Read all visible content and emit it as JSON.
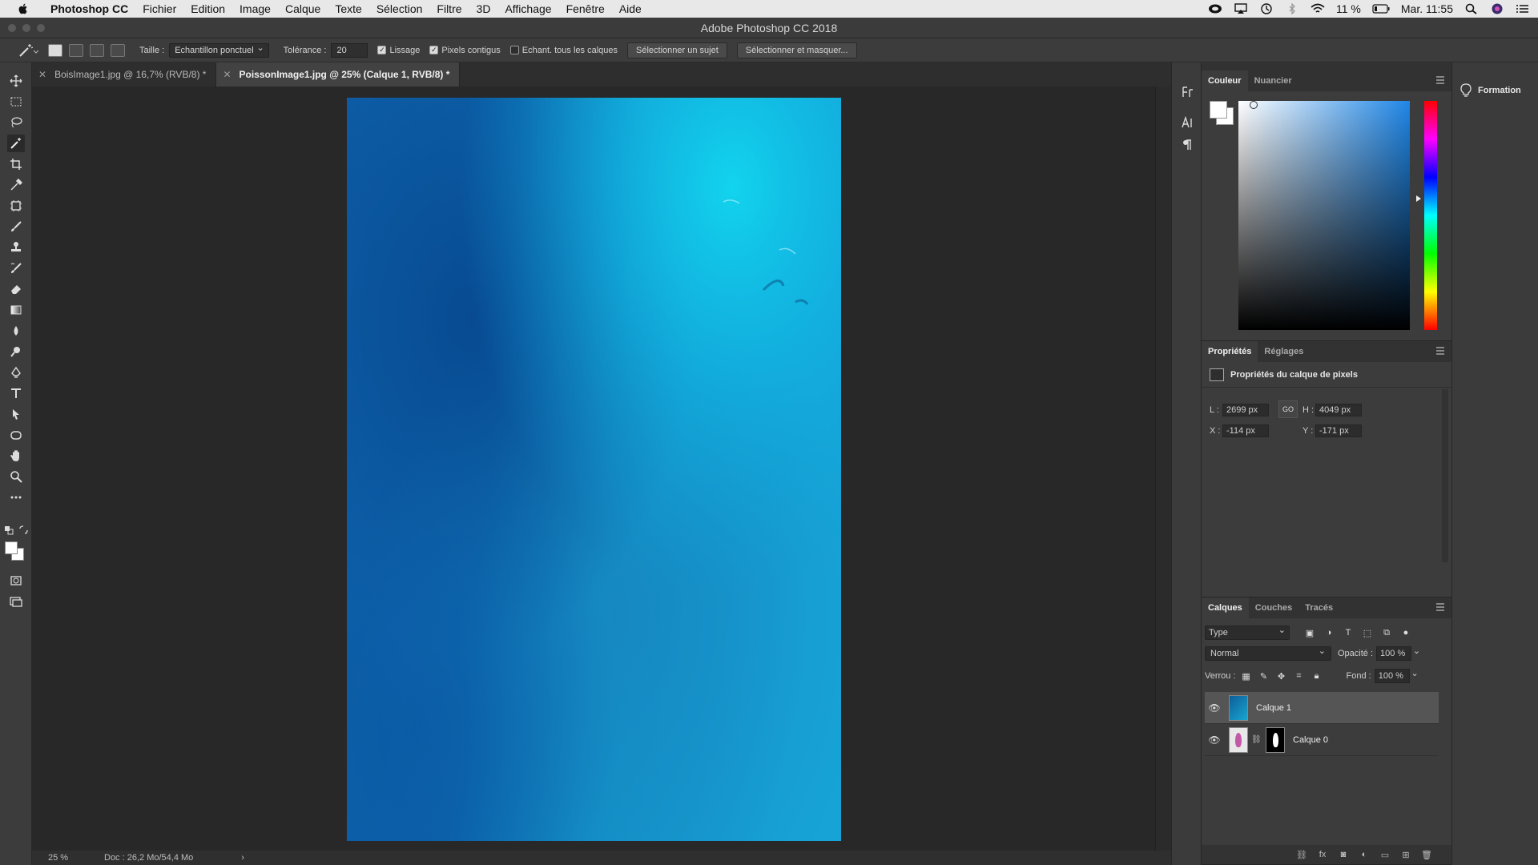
{
  "menubar": {
    "app": "Photoshop CC",
    "items": [
      "Fichier",
      "Edition",
      "Image",
      "Calque",
      "Texte",
      "Sélection",
      "Filtre",
      "3D",
      "Affichage",
      "Fenêtre",
      "Aide"
    ],
    "battery": "11 %",
    "clock": "Mar. 11:55"
  },
  "window": {
    "title": "Adobe Photoshop CC 2018"
  },
  "options": {
    "size_label": "Taille :",
    "size_value": "Echantillon ponctuel",
    "tolerance_label": "Tolérance :",
    "tolerance_value": "20",
    "antialias": {
      "label": "Lissage",
      "checked": true
    },
    "contiguous": {
      "label": "Pixels contigus",
      "checked": true
    },
    "sample_all": {
      "label": "Echant. tous les calques",
      "checked": false
    },
    "select_subject": "Sélectionner un sujet",
    "select_mask": "Sélectionner et masquer..."
  },
  "tabs": [
    {
      "label": "BoisImage1.jpg @ 16,7% (RVB/8) *",
      "active": false
    },
    {
      "label": "PoissonImage1.jpg @ 25% (Calque 1, RVB/8) *",
      "active": true
    }
  ],
  "status": {
    "zoom": "25 %",
    "doc": "Doc : 26,2 Mo/54,4 Mo",
    "arrow": "›"
  },
  "color_panel": {
    "tabs": [
      "Couleur",
      "Nuancier"
    ],
    "foreground": "#ffffff",
    "hue": "#1f86e6"
  },
  "properties_panel": {
    "tabs": [
      "Propriétés",
      "Réglages"
    ],
    "section_title": "Propriétés du calque de pixels",
    "w_label": "L :",
    "w_value": "2699 px",
    "h_label": "H :",
    "h_value": "4049 px",
    "x_label": "X :",
    "x_value": "-114 px",
    "y_label": "Y :",
    "y_value": "-171 px",
    "link_label": "GO"
  },
  "layers_panel": {
    "tabs": [
      "Calques",
      "Couches",
      "Tracés"
    ],
    "filter": "Type",
    "blend_mode": "Normal",
    "opacity_label": "Opacité :",
    "opacity_value": "100 %",
    "lock_label": "Verrou :",
    "fill_label": "Fond :",
    "fill_value": "100 %",
    "layers": [
      {
        "name": "Calque 1",
        "visible": true,
        "selected": true
      },
      {
        "name": "Calque 0",
        "visible": true,
        "selected": false
      }
    ]
  },
  "learn_panel": {
    "label": "Formation"
  },
  "tools": [
    "move-tool",
    "marquee-tool",
    "lasso-tool",
    "magic-wand-tool",
    "crop-tool",
    "eyedropper-tool",
    "healing-tool",
    "brush-tool",
    "stamp-tool",
    "history-brush-tool",
    "eraser-tool",
    "gradient-tool",
    "blur-tool",
    "dodge-tool",
    "pen-tool",
    "type-tool",
    "path-selection-tool",
    "shape-tool",
    "hand-tool",
    "zoom-tool",
    "more-tools"
  ]
}
